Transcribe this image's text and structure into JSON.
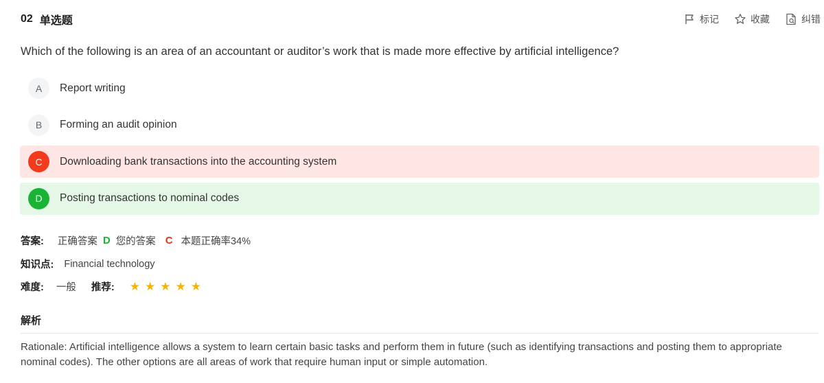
{
  "header": {
    "number": "02",
    "type": "单选题",
    "actions": [
      {
        "label": "标记",
        "icon": "flag-icon"
      },
      {
        "label": "收藏",
        "icon": "star-outline-icon"
      },
      {
        "label": "纠错",
        "icon": "error-report-icon"
      }
    ]
  },
  "question": "Which of the following is an area of an accountant or auditor’s work that is made more effective by artificial intelligence?",
  "options": [
    {
      "letter": "A",
      "text": "Report writing",
      "state": "normal"
    },
    {
      "letter": "B",
      "text": "Forming an audit opinion",
      "state": "normal"
    },
    {
      "letter": "C",
      "text": "Downloading bank transactions into the accounting system",
      "state": "wrong"
    },
    {
      "letter": "D",
      "text": "Posting transactions to nominal codes",
      "state": "correct"
    }
  ],
  "answer": {
    "label": "答案:",
    "correct_label": "正确答案",
    "correct_value": "D",
    "yours_label": "您的答案",
    "yours_value": "C",
    "rate_text": "本题正确率34%"
  },
  "knowledge": {
    "label": "知识点:",
    "value": "Financial technology"
  },
  "difficulty": {
    "label": "难度:",
    "value": "一般",
    "recommend_label": "推荐:",
    "stars": 5
  },
  "analysis": {
    "title": "解析",
    "text": "Rationale: Artificial intelligence allows a system to learn certain basic tasks and perform them in future (such as identifying transactions and posting them to appropriate nominal codes). The other options are all areas of work that require human input or simple automation."
  },
  "colors": {
    "correct": "#19b335",
    "wrong": "#f23a1d",
    "star": "#f5b400"
  }
}
